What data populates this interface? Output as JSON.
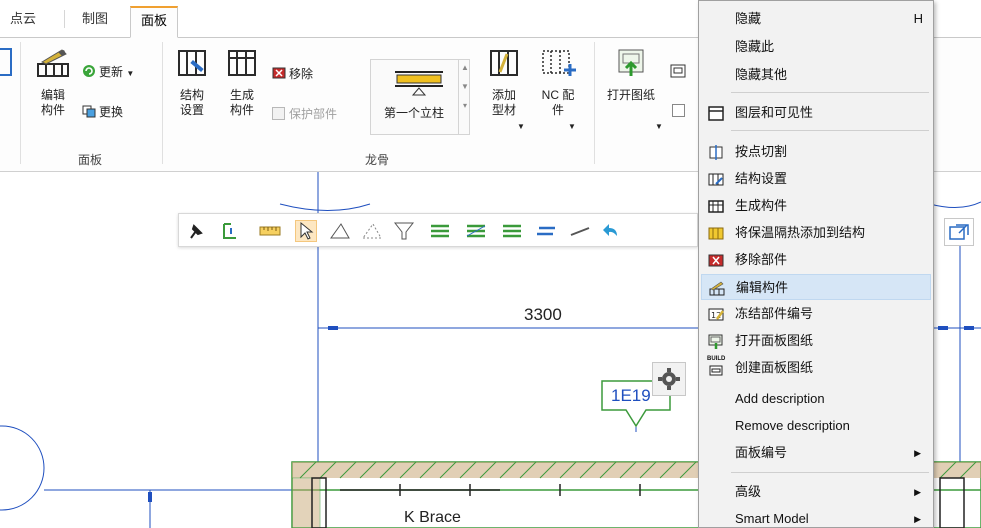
{
  "ribbon": {
    "tabs": [
      {
        "label": "点云",
        "active": false
      },
      {
        "label": "制图",
        "active": false
      },
      {
        "label": "面板",
        "active": true
      }
    ],
    "groups": [
      {
        "label": "面板"
      },
      {
        "label": "龙骨"
      }
    ],
    "buttons": {
      "edit_component": "编辑\n构件",
      "update": "更新",
      "replace": "更换",
      "structure_settings": "结构\n设置",
      "create_component": "生成\n构件",
      "remove": "移除",
      "protect_part": "保护部件",
      "first_stud": "第一个立柱",
      "add_profile": "添加\n型材",
      "nc_config": "NC 配\n件",
      "open_drawing": "打开图纸"
    },
    "colors": {
      "accent_tab": "#f0a030",
      "menu_highlight": "#d6e6f6",
      "drawing_line": "#1f4fbf",
      "wall_green": "#3c9a3c"
    }
  },
  "canvas": {
    "dimension_value": "3300",
    "tag_label": "1E19",
    "wall_label": "K Brace",
    "mini_toolbar_icons": [
      "pin-icon",
      "rotate-icon",
      "ruler-icon",
      "cursor-icon",
      "triangle-icon",
      "triangle-dotted-icon",
      "filter-icon",
      "layers-icon",
      "layers2-icon",
      "layers3-icon",
      "layers4-icon",
      "line-icon",
      "undo-icon"
    ]
  },
  "context_menu": {
    "items": [
      {
        "label": "隐藏",
        "shortcut": "H",
        "icon": "",
        "submenu": false,
        "highlighted": false
      },
      {
        "label": "隐藏此",
        "shortcut": "",
        "icon": "",
        "submenu": false,
        "highlighted": false
      },
      {
        "label": "隐藏其他",
        "shortcut": "",
        "icon": "",
        "submenu": false,
        "highlighted": false
      },
      {
        "label": "图层和可见性",
        "shortcut": "",
        "icon": "layers-window-icon",
        "submenu": false,
        "highlighted": false
      },
      {
        "label": "按点切割",
        "shortcut": "",
        "icon": "cut-point-icon",
        "submenu": false,
        "highlighted": false
      },
      {
        "label": "结构设置",
        "shortcut": "",
        "icon": "structure-settings-icon",
        "submenu": false,
        "highlighted": false
      },
      {
        "label": "生成构件",
        "shortcut": "",
        "icon": "create-component-icon",
        "submenu": false,
        "highlighted": false
      },
      {
        "label": "将保温隔热添加到结构",
        "shortcut": "",
        "icon": "insulation-icon",
        "submenu": false,
        "highlighted": false
      },
      {
        "label": "移除部件",
        "shortcut": "",
        "icon": "remove-part-icon",
        "submenu": false,
        "highlighted": false
      },
      {
        "label": "编辑构件",
        "shortcut": "",
        "icon": "edit-component-icon",
        "submenu": false,
        "highlighted": true
      },
      {
        "label": "冻结部件编号",
        "shortcut": "",
        "icon": "freeze-number-icon",
        "submenu": false,
        "highlighted": false
      },
      {
        "label": "打开面板图纸",
        "shortcut": "",
        "icon": "open-panel-drawing-icon",
        "submenu": false,
        "highlighted": false
      },
      {
        "label": "创建面板图纸",
        "shortcut": "",
        "icon": "build-drawing-icon",
        "submenu": false,
        "highlighted": false
      },
      {
        "label": "Add description",
        "shortcut": "",
        "icon": "",
        "submenu": false,
        "highlighted": false
      },
      {
        "label": "Remove description",
        "shortcut": "",
        "icon": "",
        "submenu": false,
        "highlighted": false
      },
      {
        "label": "面板编号",
        "shortcut": "",
        "icon": "",
        "submenu": true,
        "highlighted": false
      },
      {
        "label": "高级",
        "shortcut": "",
        "icon": "",
        "submenu": true,
        "highlighted": false
      },
      {
        "label": "Smart Model",
        "shortcut": "",
        "icon": "",
        "submenu": true,
        "highlighted": false
      }
    ],
    "build_badge": "BUILD"
  }
}
